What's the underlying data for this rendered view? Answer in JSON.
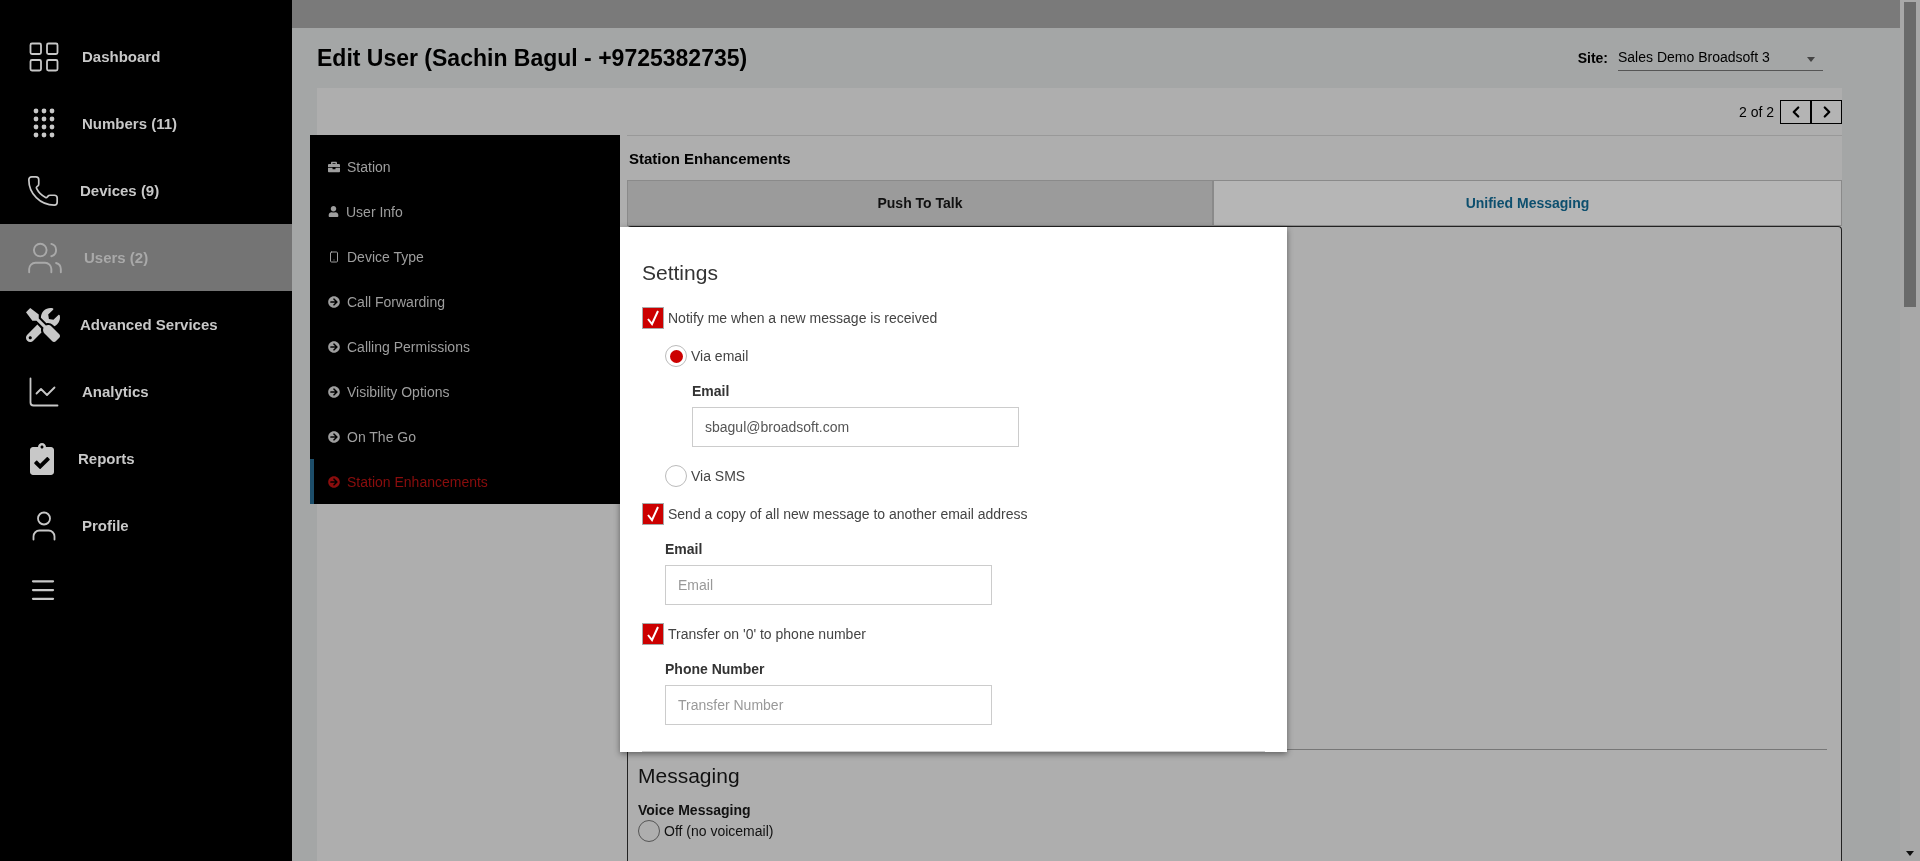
{
  "sidebar": {
    "items": [
      {
        "label": "Dashboard",
        "selected": false
      },
      {
        "label": "Numbers (11)",
        "selected": false
      },
      {
        "label": "Devices (9)",
        "selected": false
      },
      {
        "label": "Users (2)",
        "selected": true
      },
      {
        "label": "Advanced Services",
        "selected": false
      },
      {
        "label": "Analytics",
        "selected": false
      },
      {
        "label": "Reports",
        "selected": false
      },
      {
        "label": "Profile",
        "selected": false
      }
    ]
  },
  "header": {
    "title": "Edit User (Sachin Bagul - +9725382735)",
    "site_label": "Site:",
    "site_value": "Sales Demo Broadsoft 3"
  },
  "pager": {
    "text": "2 of 2"
  },
  "subnav": {
    "items": [
      {
        "label": "Station",
        "selected": false
      },
      {
        "label": "User Info",
        "selected": false
      },
      {
        "label": "Device Type",
        "selected": false
      },
      {
        "label": "Call Forwarding",
        "selected": false
      },
      {
        "label": "Calling Permissions",
        "selected": false
      },
      {
        "label": "Visibility Options",
        "selected": false
      },
      {
        "label": "On The Go",
        "selected": false
      },
      {
        "label": "Station Enhancements",
        "selected": true
      }
    ]
  },
  "section": {
    "title": "Station Enhancements",
    "tabs": [
      {
        "label": "Push To Talk",
        "selected": false
      },
      {
        "label": "Unified Messaging",
        "selected": true
      }
    ]
  },
  "settings": {
    "title": "Settings",
    "items": [
      {
        "kind": "checkbox",
        "label": "Notify me when a new message is received",
        "checked": true,
        "children": [
          {
            "kind": "radio",
            "label": "Via email",
            "selected": true,
            "children": [
              {
                "kind": "field",
                "label": "Email",
                "value": "sbagul@broadsoft.com"
              }
            ]
          },
          {
            "kind": "radio",
            "label": "Via SMS",
            "selected": false
          }
        ]
      },
      {
        "kind": "checkbox",
        "label": "Send a copy of all new message to another email address",
        "checked": true,
        "children": [
          {
            "kind": "field",
            "label": "Email",
            "placeholder": "Email"
          }
        ]
      },
      {
        "kind": "checkbox",
        "label": "Transfer on '0' to phone number",
        "checked": true,
        "children": [
          {
            "kind": "field",
            "label": "Phone Number",
            "placeholder": "Transfer Number"
          }
        ]
      }
    ]
  },
  "messaging": {
    "title": "Messaging",
    "group_label": "Voice Messaging",
    "options": [
      {
        "label": "Off (no voicemail)",
        "selected": false
      }
    ]
  }
}
